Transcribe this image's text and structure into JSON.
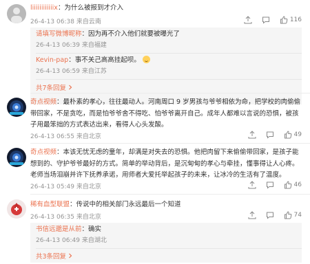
{
  "comments": [
    {
      "username": "liiiiiiiiiiiix",
      "text": "：为什么被报到才介入",
      "time": "26-4-13 06:38",
      "location": "来自云南",
      "likes": "116",
      "replies": [
        {
          "username": "请填写微博昵称",
          "text": "：因为再不介入他们就要被曝光了",
          "time": "26-4-13 06:39",
          "location": "来自福建"
        },
        {
          "username": "Kevin-pap",
          "text": "：事不关己高高挂起呗。",
          "time": "26-4-13 06:59",
          "location": "来自江苏"
        }
      ],
      "more_replies": "共7条回复"
    },
    {
      "username": "奇点视频",
      "text": "：最朴素的孝心，往往最动人。河南周口 9 岁男孩与爷爷相依为命，把学校的肉偷偷带回家，不是贪吃，而是怕爷爷舍不得吃、怕爷爷离开自己。成年人都难以言说的恐惧，被孩子用最笨拙的方式表达出来，看得人心头发酸。",
      "time": "26-4-13 06:55",
      "location": "来自北京",
      "likes": "49"
    },
    {
      "username": "奇点视频",
      "text": "：本该无忧无虑的童年，却满是对失去的恐惧。他把肉留下来偷偷带回家，是孩子能想到的、守护爷爷最好的方式。简单的举动背后，是沉甸甸的孝心与牵挂，懂事得让人心疼。老师当场泪崩并许下抚养承诺，用师者大爱托举起孩子的未来，让冰冷的生活有了温度。",
      "time": "26-4-13 05:49",
      "location": "来自北京",
      "likes": "46"
    },
    {
      "username": "稀有血型联盟",
      "text": "：传说中的相关部门永远最后一个知道",
      "time": "26-4-13 06:35",
      "location": "来自北京",
      "likes": "74",
      "replies": [
        {
          "username": "书信远邈是从前",
          "text": "：确实",
          "time": "26-4-13 06:49",
          "location": "来自湖北"
        }
      ],
      "more_replies": "共3条回复"
    }
  ],
  "colors": {
    "username": "#eb7350",
    "meta": "#939393",
    "reply_bg": "#f5f5f5"
  },
  "icons": [
    "share-icon",
    "comment-icon",
    "like-icon",
    "chevron-right-icon"
  ]
}
